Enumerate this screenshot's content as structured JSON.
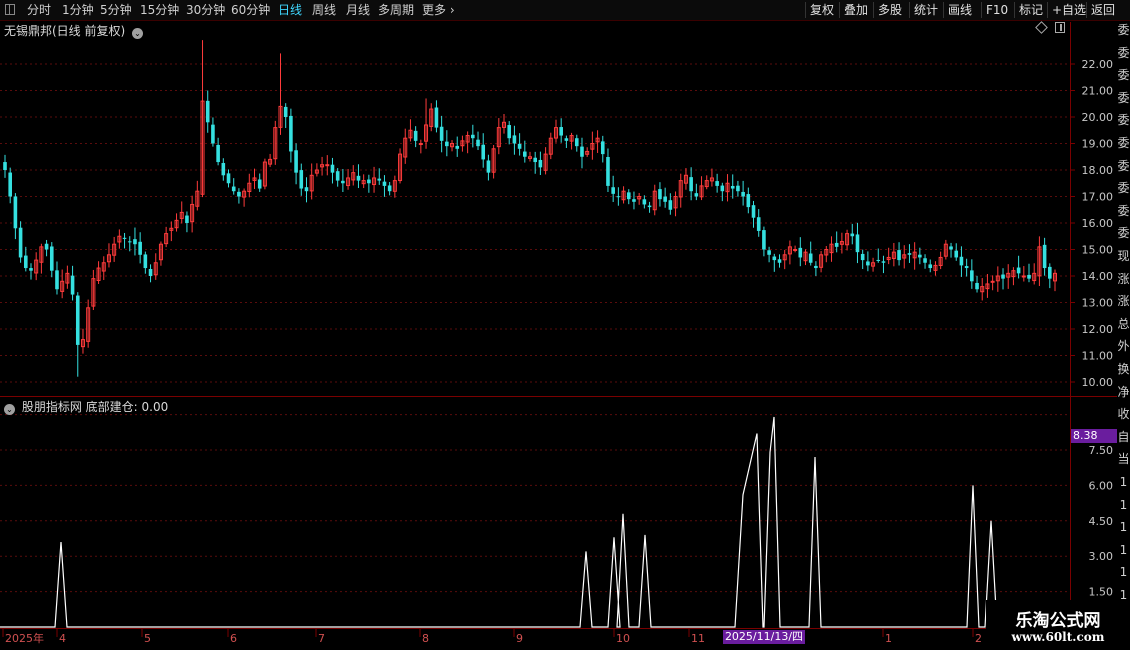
{
  "toolbar": {
    "left_items": [
      {
        "label": "分时",
        "active": false
      },
      {
        "label": "1分钟",
        "active": false
      },
      {
        "label": "5分钟",
        "active": false
      },
      {
        "label": "15分钟",
        "active": false
      },
      {
        "label": "30分钟",
        "active": false
      },
      {
        "label": "60分钟",
        "active": false
      },
      {
        "label": "日线",
        "active": true
      },
      {
        "label": "周线",
        "active": false
      },
      {
        "label": "月线",
        "active": false
      },
      {
        "label": "多周期",
        "active": false
      },
      {
        "label": "更多",
        "active": false
      }
    ],
    "more_chevron": "›",
    "right_items": [
      "复权",
      "叠加",
      "多股",
      "统计",
      "画线",
      "F10",
      "标记",
      "+自选",
      "返回"
    ]
  },
  "main_chart": {
    "title": "无锡鼎邦(日线 前复权)",
    "y_ticks": [
      "22.00",
      "21.00",
      "20.00",
      "19.00",
      "18.00",
      "17.00",
      "16.00",
      "15.00",
      "14.00",
      "13.00",
      "12.00",
      "11.00",
      "10.00"
    ]
  },
  "indicator": {
    "title": "股朋指标网 底部建仓: 0.00",
    "current_value": "8.38",
    "y_ticks": [
      "7.50",
      "6.00",
      "4.50",
      "3.00",
      "1.50"
    ]
  },
  "x_axis": {
    "labels": [
      "2025年",
      "4",
      "5",
      "6",
      "7",
      "8",
      "9",
      "10",
      "11",
      "1",
      "2"
    ],
    "cursor_date": "2025/11/13/四"
  },
  "right_strip": [
    "委",
    "委",
    "委",
    "委",
    "委",
    "委",
    "委",
    "委",
    "委",
    "委",
    "现",
    "涨",
    "涨",
    "总",
    "外",
    "换",
    "净",
    "收",
    "自",
    "当",
    "1",
    "1",
    "1",
    "1",
    "1",
    "1",
    "1",
    "1"
  ],
  "watermark": {
    "line1": "乐淘公式网",
    "line2": "www.60lt.com"
  },
  "colors": {
    "up": "#ff3b3b",
    "down": "#35e0e0",
    "indicator_line": "#ffffff",
    "grid": "#5a0c0c",
    "active_tab": "#3fd7ff",
    "highlight": "#6a1d9e"
  },
  "chart_data": {
    "type": "candlestick",
    "ylim": [
      10,
      22
    ],
    "closes": [
      18.0,
      17.0,
      15.8,
      14.7,
      14.3,
      14.2,
      14.6,
      15.1,
      15.0,
      14.2,
      13.5,
      13.8,
      14.1,
      13.3,
      11.4,
      11.6,
      12.8,
      13.9,
      14.3,
      14.5,
      14.8,
      15.2,
      15.5,
      15.4,
      15.3,
      15.2,
      14.8,
      14.3,
      14.0,
      14.5,
      15.2,
      15.6,
      15.8,
      16.1,
      16.4,
      16.0,
      16.7,
      17.2,
      20.6,
      19.8,
      19.0,
      18.3,
      17.8,
      17.5,
      17.2,
      17.0,
      17.2,
      17.5,
      17.7,
      17.3,
      18.3,
      18.4,
      19.6,
      20.4,
      20.0,
      18.7,
      17.9,
      17.3,
      17.2,
      17.8,
      18.0,
      18.2,
      18.2,
      17.9,
      17.6,
      17.5,
      17.7,
      17.9,
      17.6,
      17.6,
      17.5,
      17.7,
      17.6,
      17.4,
      17.2,
      17.6,
      18.6,
      19.2,
      19.5,
      19.1,
      19.0,
      19.7,
      20.3,
      19.6,
      19.1,
      18.9,
      19.0,
      18.8,
      19.1,
      19.3,
      19.2,
      18.9,
      18.4,
      17.9,
      18.8,
      19.6,
      19.8,
      19.2,
      19.0,
      18.8,
      18.5,
      18.5,
      18.3,
      18.1,
      18.6,
      19.2,
      19.6,
      19.3,
      19.1,
      19.3,
      18.9,
      18.5,
      18.7,
      19.0,
      19.2,
      18.6,
      17.4,
      17.1,
      17.0,
      17.2,
      16.9,
      16.8,
      17.0,
      16.7,
      16.6,
      17.2,
      16.9,
      16.8,
      16.5,
      17.0,
      17.6,
      17.8,
      17.2,
      17.0,
      17.4,
      17.6,
      17.7,
      17.4,
      17.2,
      17.5,
      17.3,
      17.2,
      17.0,
      16.6,
      16.2,
      15.7,
      15.0,
      14.8,
      14.6,
      14.5,
      14.8,
      15.1,
      15.0,
      14.7,
      14.9,
      14.5,
      14.3,
      14.8,
      15.0,
      15.2,
      15.1,
      15.3,
      15.6,
      15.5,
      14.9,
      14.6,
      14.4,
      14.5,
      14.6,
      14.5,
      14.7,
      14.9,
      14.6,
      14.8,
      14.8,
      14.9,
      14.7,
      14.5,
      14.3,
      14.4,
      14.7,
      15.2,
      15.0,
      14.7,
      14.4,
      14.3,
      13.8,
      13.5,
      13.6,
      13.7,
      13.8,
      14.0,
      13.9,
      14.1,
      14.2,
      14.1,
      14.0,
      13.9,
      14.1,
      15.1,
      14.3,
      13.9,
      14.1
    ]
  }
}
